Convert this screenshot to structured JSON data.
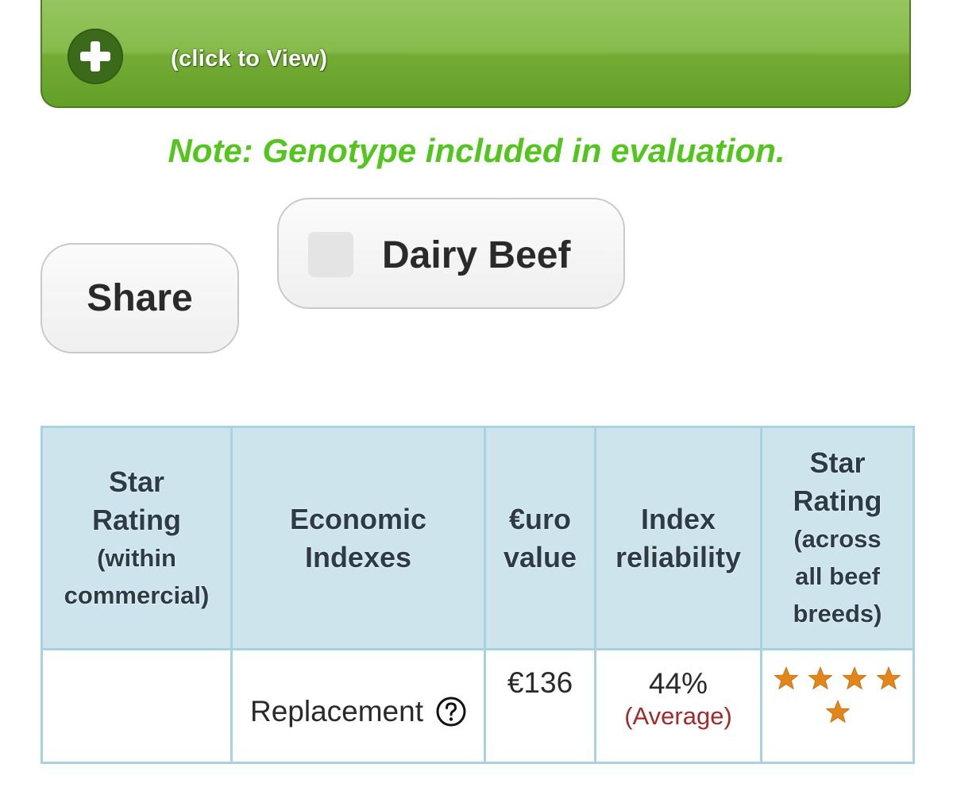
{
  "expander": {
    "label": "(click to View)",
    "icon": "plus-icon"
  },
  "note": "Note: Genotype included in evaluation.",
  "buttons": {
    "share": "Share",
    "dairy_beef": "Dairy Beef",
    "dairy_beef_checked": false
  },
  "table": {
    "headers": {
      "star_rating_within": {
        "main": "Star Rating",
        "sub": "(within commercial)"
      },
      "economic_indexes": "Economic Indexes",
      "euro_value": "€uro value",
      "index_reliability": "Index reliability",
      "star_rating_across": {
        "main": "Star Rating",
        "sub": "(across all beef breeds)"
      }
    },
    "rows": [
      {
        "star_rating_within": "",
        "index": "Replacement",
        "euro": "€136",
        "reliability": "44%",
        "reliability_label": "(Average)",
        "stars_across": 5
      }
    ]
  },
  "colors": {
    "accent_green": "#54c41f",
    "expander_green": "#86bb4b",
    "table_header_bg": "#cde4ec",
    "table_border": "#a8d2df",
    "reliability_label": "#a12a2a",
    "star": "#e0861a"
  }
}
